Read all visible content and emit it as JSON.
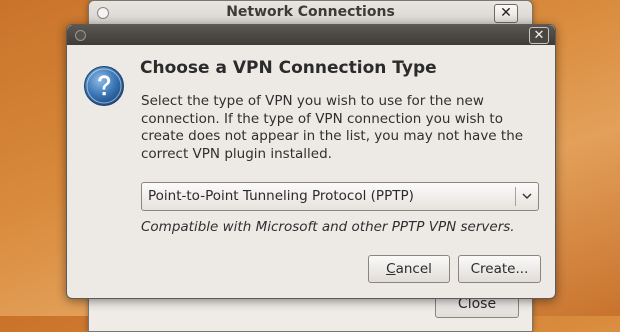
{
  "background_window": {
    "title": "Network Connections",
    "close_glyph": "✕",
    "close_button_label": "Close"
  },
  "dialog": {
    "close_glyph": "✕",
    "icon": "question-icon",
    "heading": "Choose a VPN Connection Type",
    "description": "Select the type of VPN you wish to use for the new connection.  If the type of VPN connection you wish to create does not appear in the list, you may not have the correct VPN plugin installed.",
    "vpn_type": {
      "selected": "Point-to-Point Tunneling Protocol (PPTP)"
    },
    "compat_note": "Compatible with Microsoft and other PPTP VPN servers.",
    "buttons": {
      "cancel_first": "C",
      "cancel_rest": "ancel",
      "create": "Create..."
    }
  },
  "colors": {
    "desktop": "#d98b3c",
    "dialog_bg": "#edeae6",
    "titlebar_dark": "#3f3c38",
    "question_icon_blue": "#3a76b5"
  }
}
